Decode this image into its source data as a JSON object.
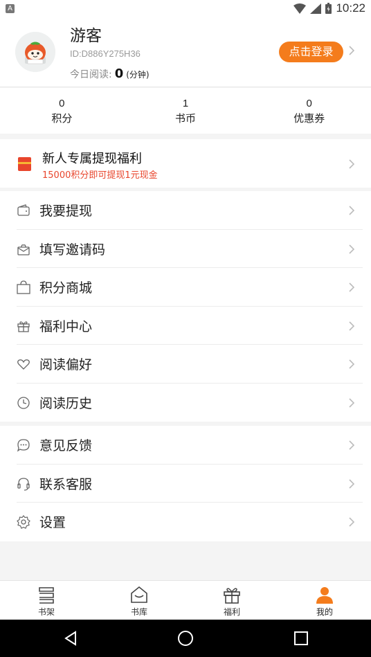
{
  "status_bar": {
    "time": "10:22",
    "notification_icon": "A"
  },
  "profile": {
    "avatar_icon": "tomato-avatar-icon",
    "username": "游客",
    "user_id": "ID:D886Y275H36",
    "read_label": "今日阅读:",
    "read_value": "0",
    "read_unit": "(分钟)",
    "login_button": "点击登录"
  },
  "stats": [
    {
      "value": "0",
      "label": "积分"
    },
    {
      "value": "1",
      "label": "书币"
    },
    {
      "value": "0",
      "label": "优惠券"
    }
  ],
  "promo": {
    "icon": "red-packet-icon",
    "title": "新人专属提现福利",
    "subtitle": "15000积分即可提现1元现金",
    "accent": "#e8452c"
  },
  "menu_group_1": [
    {
      "icon": "wallet-icon",
      "label": "我要提现"
    },
    {
      "icon": "invite-envelope-icon",
      "label": "填写邀请码"
    },
    {
      "icon": "shopping-bag-icon",
      "label": "积分商城"
    },
    {
      "icon": "gift-icon",
      "label": "福利中心"
    },
    {
      "icon": "heart-icon",
      "label": "阅读偏好"
    },
    {
      "icon": "clock-icon",
      "label": "阅读历史"
    }
  ],
  "menu_group_2": [
    {
      "icon": "chat-bubble-icon",
      "label": "意见反馈"
    },
    {
      "icon": "headset-icon",
      "label": "联系客服"
    },
    {
      "icon": "gear-icon",
      "label": "设置"
    }
  ],
  "tabs": [
    {
      "icon": "bookshelf-icon",
      "label": "书架"
    },
    {
      "icon": "library-icon",
      "label": "书库"
    },
    {
      "icon": "gift-icon",
      "label": "福利"
    },
    {
      "icon": "person-icon",
      "label": "我的",
      "active": true
    }
  ],
  "colors": {
    "accent": "#f47c1c",
    "promo_red": "#e8452c"
  }
}
